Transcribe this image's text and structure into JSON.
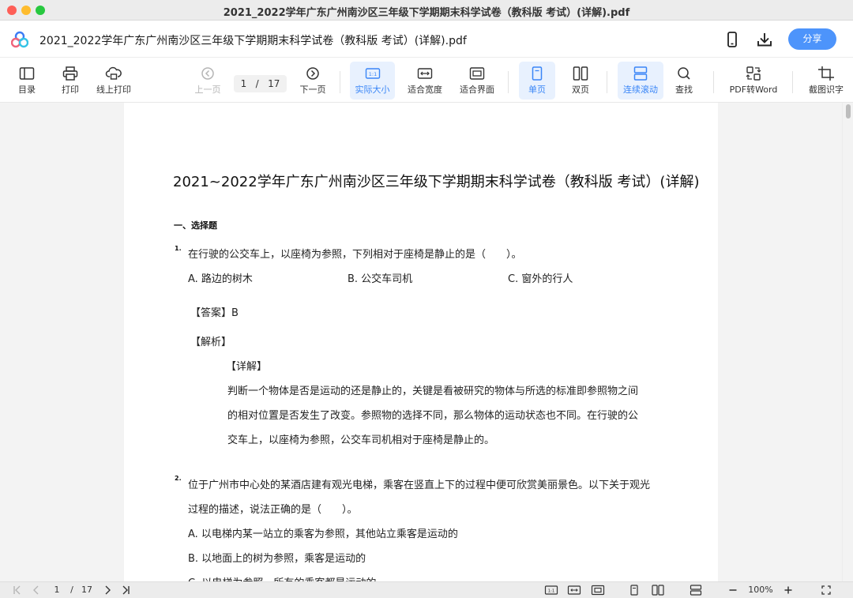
{
  "window": {
    "title": "2021_2022学年广东广州南沙区三年级下学期期末科学试卷（教科版 考试）(详解).pdf"
  },
  "header": {
    "doc_name": "2021_2022学年广东广州南沙区三年级下学期期末科学试卷（教科版 考试）(详解).pdf",
    "share_label": "分享",
    "phone_icon": "phone-icon",
    "download_icon": "download-icon"
  },
  "toolbar": {
    "toc": "目录",
    "print": "打印",
    "online_print": "线上打印",
    "prev_page": "上一页",
    "current_page": "1",
    "page_sep": "/",
    "total_pages": "17",
    "next_page": "下一页",
    "actual_size": "实际大小",
    "fit_width": "适合宽度",
    "fit_page": "适合界面",
    "single_page": "单页",
    "double_page": "双页",
    "continuous_scroll": "连续滚动",
    "find": "查找",
    "pdf_to_word": "PDF转Word",
    "ocr": "截图识字"
  },
  "document": {
    "title": "2021~2022学年广东广州南沙区三年级下学期期末科学试卷（教科版 考试）(详解)",
    "section": "一、选择题",
    "q1": {
      "num": "1.",
      "stem": "在行驶的公交车上，以座椅为参照，下列相对于座椅是静止的是（　　）。",
      "option_a": "A. 路边的树木",
      "option_b": "B. 公交车司机",
      "option_c": "C. 窗外的行人",
      "answer": "【答案】B",
      "analysis_label": "【解析】",
      "detail_label": "【详解】",
      "detail_lines": [
        "判断一个物体是否是运动的还是静止的，关键是看被研究的物体与所选的标准即参照物之间",
        "的相对位置是否发生了改变。参照物的选择不同，那么物体的运动状态也不同。在行驶的公",
        "交车上，以座椅为参照，公交车司机相对于座椅是静止的。"
      ]
    },
    "q2": {
      "num": "2.",
      "stem_line1": "位于广州市中心处的某酒店建有观光电梯，乘客在竖直上下的过程中便可欣赏美丽景色。以下关于观光",
      "stem_line2": "过程的描述，说法正确的是（　　）。",
      "option_a": "A. 以电梯内某一站立的乘客为参照，其他站立乘客是运动的",
      "option_b": "B. 以地面上的树为参照，乘客是运动的",
      "option_c": "C. 以电梯为参照，所有的乘客都是运动的"
    }
  },
  "statusbar": {
    "current_page": "1",
    "page_sep": "/",
    "total_pages": "17",
    "zoom": "100%"
  },
  "colors": {
    "accent": "#3a86f7",
    "share_button": "#4d94fb",
    "active_bg": "#e8f1fe"
  }
}
